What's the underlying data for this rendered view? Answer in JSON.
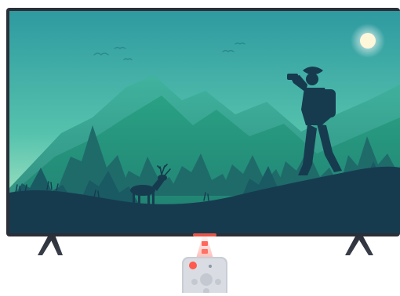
{
  "scene": {
    "subject": "television-with-remote",
    "screen_content": "mountain-landscape-with-hiker-and-deer",
    "colors": {
      "tv_frame": "#2b2f38",
      "sky_top": "#3aa6a0",
      "sky_bottom": "#a7e7c4",
      "sun": "#fff7d9",
      "mountain_far": "#2fa184",
      "mountain_mid": "#2e8f7b",
      "forest": "#1f6b6a",
      "foreground": "#163b4f",
      "silhouette": "#163b4f",
      "remote_body": "#c9cdd4",
      "remote_button": "#ff5a4b",
      "ir_beam": "#ff5a4b"
    },
    "icons": [
      "tv-icon",
      "remote-control-icon",
      "sun-icon",
      "hiker-icon",
      "deer-icon",
      "bird-icon"
    ]
  }
}
